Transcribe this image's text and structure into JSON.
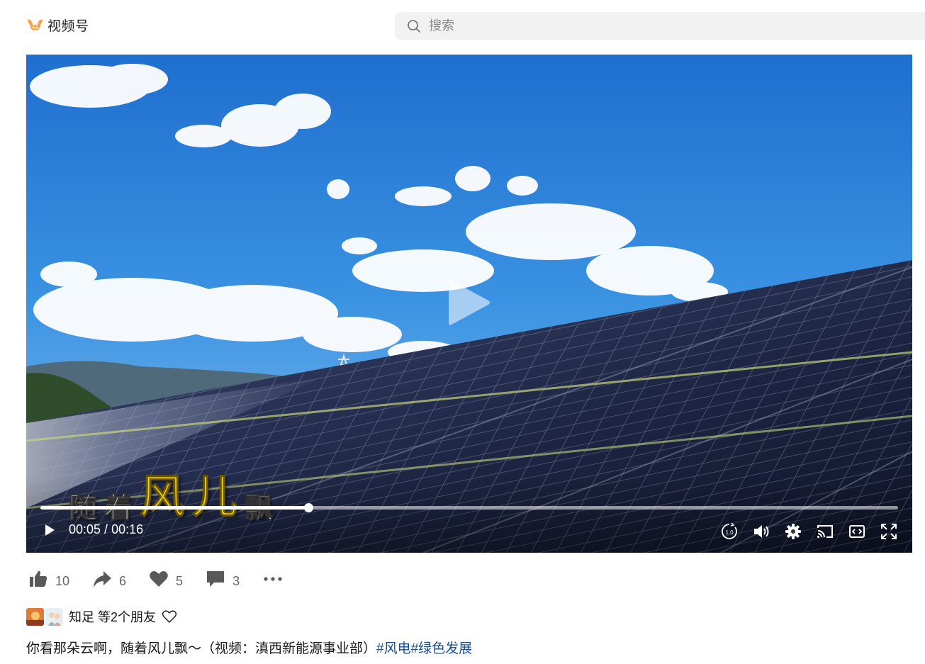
{
  "app": {
    "brand_name": "视频号",
    "brand_icon": "channels-logo-icon",
    "accent": "#fa9d3b"
  },
  "search": {
    "placeholder": "搜索",
    "value": ""
  },
  "video": {
    "caption_words": [
      "随",
      "着",
      "风",
      "儿",
      "飘"
    ],
    "current_time": "00:05",
    "separator": "/",
    "duration": "00:16",
    "progress": 0.3125,
    "speed_label": "1.0"
  },
  "actions": {
    "like_count": "10",
    "share_count": "6",
    "favorite_count": "5",
    "comment_count": "3"
  },
  "friends": {
    "text": "知足 等2个朋友"
  },
  "description": {
    "text": "你看那朵云啊，随着风儿飘～（视频：滇西新能源事业部）",
    "tags": [
      "#风电",
      "#绿色发展"
    ]
  }
}
